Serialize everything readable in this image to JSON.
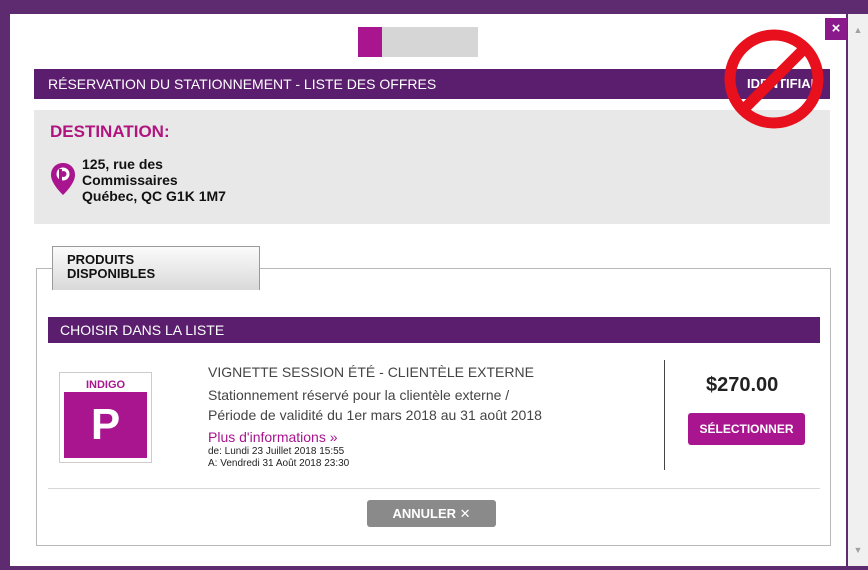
{
  "progress": {
    "fraction": 0.2
  },
  "close_label": "×",
  "header": {
    "title": "RÉSERVATION DU STATIONNEMENT - LISTE DES OFFRES",
    "right_label": "IDENTIFIAN"
  },
  "destination": {
    "heading": "DESTINATION:",
    "address_line1": "125, rue des",
    "address_line2": "Commissaires",
    "address_line3": "Québec, QC G1K 1M7"
  },
  "tab": {
    "line1": "PRODUITS",
    "line2": "DISPONIBLES"
  },
  "list": {
    "heading": "CHOISIR DANS LA LISTE",
    "products": [
      {
        "brand": "INDIGO",
        "logo_letter": "P",
        "title": "VIGNETTE SESSION ÉTÉ - CLIENTÈLE EXTERNE",
        "desc_line1": "Stationnement réservé pour la clientèle externe /",
        "desc_line2": "Période de validité du 1er mars 2018 au 31 août 2018",
        "more_label": "Plus d'informations »",
        "date_from": "de: Lundi 23 Juillet 2018 15:55",
        "date_to": "A: Vendredi 31 Août 2018 23:30",
        "price": "$270.00",
        "select_label": "SÉLECTIONNER"
      }
    ]
  },
  "cancel_label": "ANNULER ✕",
  "colors": {
    "brand": "#a8158f",
    "header": "#5b1e6e",
    "prohibition": "#e8101c"
  },
  "icons": {
    "pin": "location-pin-icon",
    "close": "close-icon",
    "prohibition": "no-entry-icon"
  }
}
